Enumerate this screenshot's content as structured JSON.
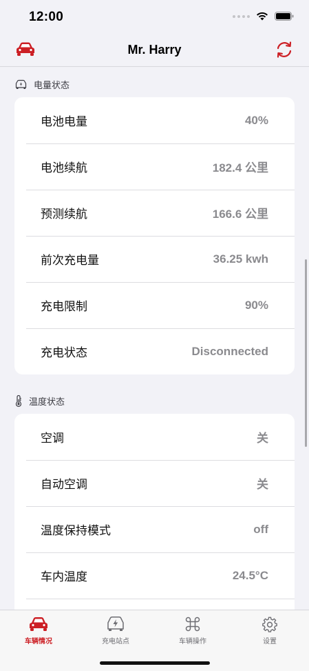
{
  "status_bar": {
    "time": "12:00"
  },
  "header": {
    "title": "Mr. Harry"
  },
  "sections": [
    {
      "title": "电量状态",
      "icon": "battery-charge-icon",
      "rows": [
        {
          "label": "电池电量",
          "value": "40%"
        },
        {
          "label": "电池续航",
          "value": "182.4 公里"
        },
        {
          "label": "预测续航",
          "value": "166.6 公里"
        },
        {
          "label": "前次充电量",
          "value": "36.25 kwh"
        },
        {
          "label": "充电限制",
          "value": "90%"
        },
        {
          "label": "充电状态",
          "value": "Disconnected"
        }
      ]
    },
    {
      "title": "温度状态",
      "icon": "thermometer-icon",
      "rows": [
        {
          "label": "空调",
          "value": "关"
        },
        {
          "label": "自动空调",
          "value": "关"
        },
        {
          "label": "温度保持模式",
          "value": "off"
        },
        {
          "label": "车内温度",
          "value": "24.5°C"
        }
      ]
    }
  ],
  "tabs": [
    {
      "label": "车辆情况",
      "icon": "car-icon",
      "active": true
    },
    {
      "label": "充电站点",
      "icon": "charging-station-icon",
      "active": false
    },
    {
      "label": "车辆操作",
      "icon": "command-icon",
      "active": false
    },
    {
      "label": "设置",
      "icon": "gear-icon",
      "active": false
    }
  ],
  "colors": {
    "accent": "#cc1f25",
    "background": "#f2f2f7",
    "value_text": "#8a8a8e"
  }
}
